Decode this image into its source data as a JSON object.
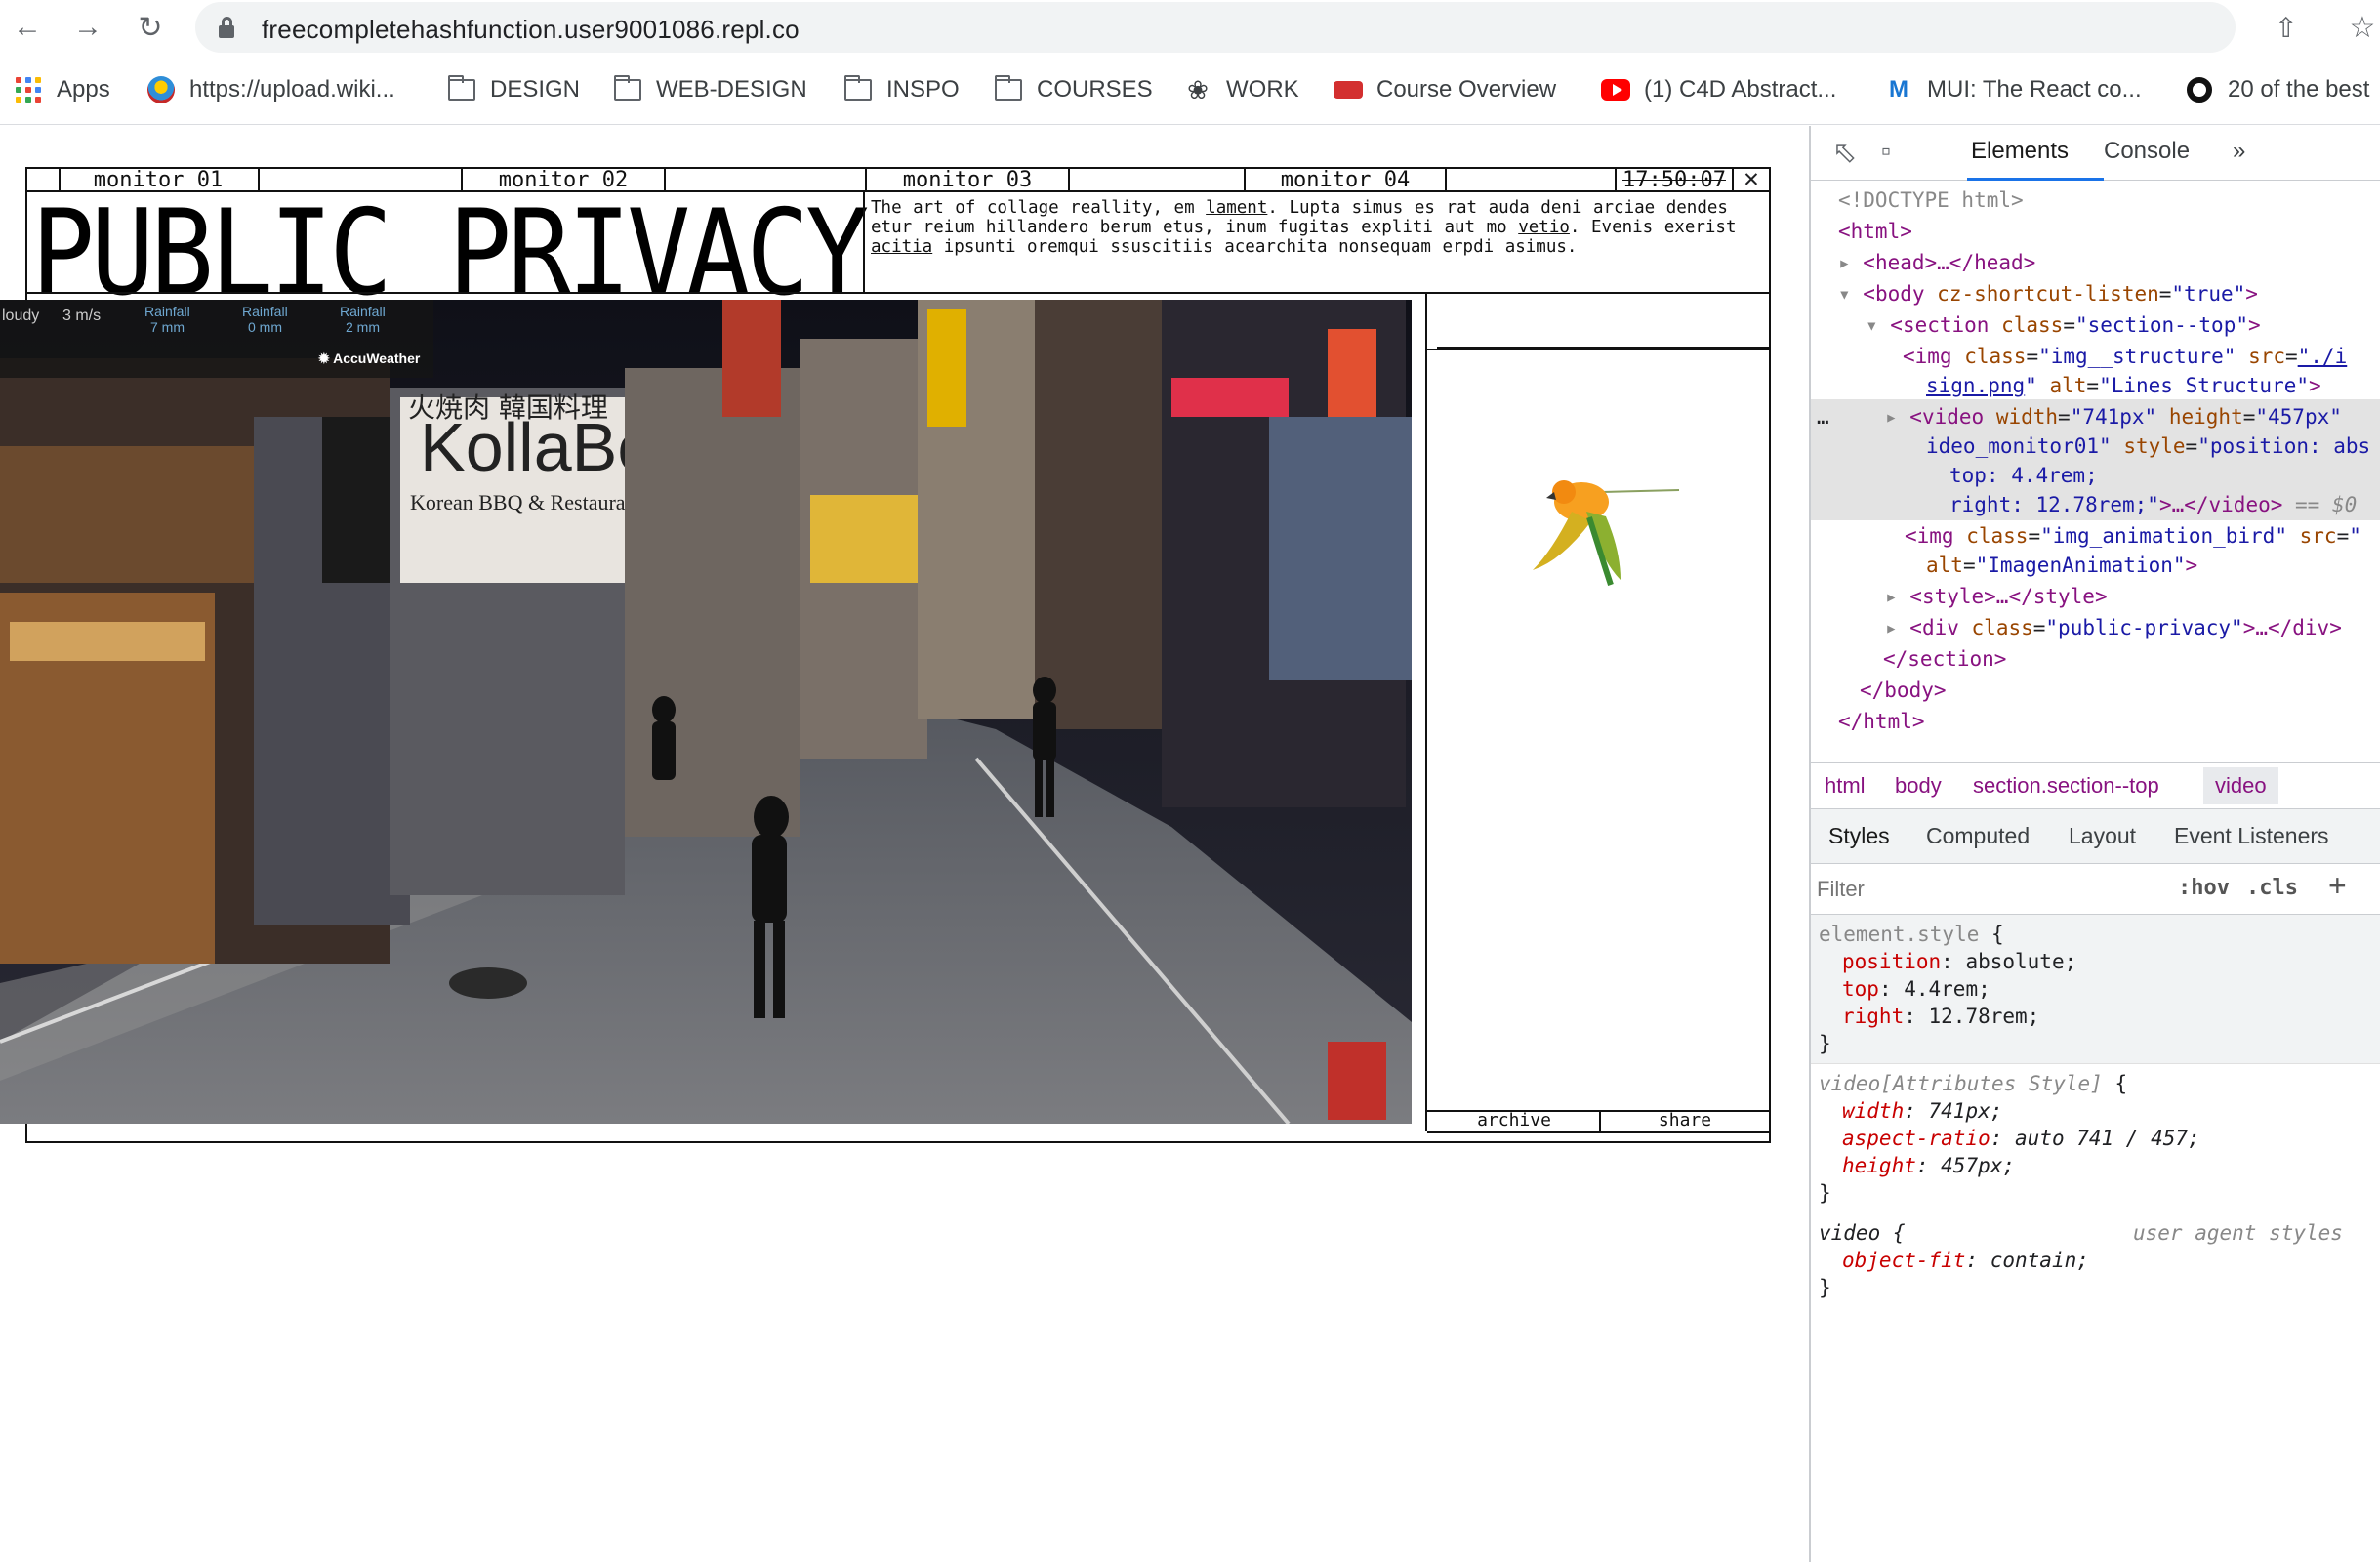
{
  "browser": {
    "url": "freecompletehashfunction.user9001086.repl.co",
    "bookmarks": [
      {
        "icon": "apps-grid-icon",
        "label": "Apps"
      },
      {
        "icon": "wikimedia-icon",
        "label": "https://upload.wiki..."
      },
      {
        "icon": "folder-icon",
        "label": "DESIGN"
      },
      {
        "icon": "folder-icon",
        "label": "WEB-DESIGN"
      },
      {
        "icon": "folder-icon",
        "label": "INSPO"
      },
      {
        "icon": "folder-icon",
        "label": "COURSES"
      },
      {
        "icon": "work-icon",
        "label": "WORK"
      },
      {
        "icon": "bus-icon",
        "label": "Course Overview"
      },
      {
        "icon": "youtube-icon",
        "label": "(1) C4D Abstract..."
      },
      {
        "icon": "mui-icon",
        "label": "MUI: The React co..."
      },
      {
        "icon": "ring-icon",
        "label": "20 of the best"
      }
    ]
  },
  "page": {
    "monitors": [
      "monitor 01",
      "monitor 02",
      "monitor 03",
      "monitor 04"
    ],
    "clock": "17:50:07",
    "close_glyph": "✕",
    "title": "PUBLIC PRIVACY",
    "description": {
      "p1": "The art of collage reallity, em ",
      "u1": "lament",
      "p2": ". Lupta simus es rat auda deni arciae dendes etur reium hillandero berum etus, inum fugitas expliti aut mo ",
      "u2": "vetio",
      "p3": ". Evenis exerist ",
      "u3": "acitia",
      "p4": " ipsunti oremqui ssuscitiis acearchita nonsequam erpdi asimus."
    },
    "weather": {
      "condition": "loudy",
      "wind": "3 m/s",
      "items": [
        {
          "label": "Rainfall",
          "value": "7 mm"
        },
        {
          "label": "Rainfall",
          "value": "0 mm"
        },
        {
          "label": "Rainfall",
          "value": "2 mm"
        }
      ],
      "brand": "AccuWeather"
    },
    "signs": {
      "restaurant": "KollaBo",
      "restaurant_sub": "Korean BBQ & Restaurant",
      "kanji_1": "火焼肉 韓国料理"
    },
    "side_buttons": [
      "archive",
      "share"
    ]
  },
  "devtools": {
    "tabs": [
      "Elements",
      "Console"
    ],
    "more": "»",
    "dom": {
      "doctype": "<!DOCTYPE html>",
      "html_open": "<html>",
      "head": "<head>…</head>",
      "body_tag": "<body",
      "body_attr": "cz-shortcut-listen",
      "body_val": "\"true\"",
      "section_tag": "<section",
      "section_attr": "class",
      "section_val": "\"section--top\"",
      "img_tag": "<img",
      "img_attr1": "class",
      "img_val1": "\"img__structure\"",
      "img_attr2": "src",
      "img_val2a": "\"./i",
      "img_val2b": "sign.png",
      "img_attr3": "alt",
      "img_val3": "\"Lines Structure\"",
      "video_tag": "<video",
      "video_attr1": "width",
      "video_val1": "\"741px\"",
      "video_attr2": "height",
      "video_val2": "\"457px\"",
      "video_val3": "ideo_monitor01\"",
      "video_attr4": "style",
      "video_val4a": "\"position: abs",
      "video_val4b": "top: 4.4rem;",
      "video_val4c": "right: 12.78rem;\"",
      "video_close": ">…</video>",
      "video_eq": "== $0",
      "bird_tag": "<img",
      "bird_attr": "class",
      "bird_val": "\"img_animation_bird\"",
      "bird_attr2": "src",
      "bird_alt": "alt",
      "bird_alt_val": "\"ImagenAnimation\"",
      "style_tag": "<style>…</style>",
      "div_tag": "<div",
      "div_attr": "class",
      "div_val": "\"public-privacy\"",
      "div_close": ">…</div>",
      "section_close": "</section>",
      "body_close": "</body>",
      "html_close": "</html>",
      "dots": "…"
    },
    "breadcrumbs": [
      "html",
      "body",
      "section.section--top",
      "video"
    ],
    "sub_tabs": [
      "Styles",
      "Computed",
      "Layout",
      "Event Listeners"
    ],
    "filter_placeholder": "Filter",
    "hov": ":hov",
    "cls": ".cls",
    "plus": "+",
    "styles": {
      "element_selector": "element.style",
      "element_props": [
        {
          "name": "position",
          "value": "absolute;"
        },
        {
          "name": "top",
          "value": "4.4rem;"
        },
        {
          "name": "right",
          "value": "12.78rem;"
        }
      ],
      "attr_selector": "video[Attributes Style]",
      "attr_props": [
        {
          "name": "width",
          "value": "741px;"
        },
        {
          "name": "aspect-ratio",
          "value": "auto 741 / 457;"
        },
        {
          "name": "height",
          "value": "457px;"
        }
      ],
      "ua_selector": "video",
      "ua_label": "user agent styles",
      "ua_props": [
        {
          "name": "object-fit",
          "value": "contain;"
        }
      ],
      "open_brace": "{",
      "close_brace": "}"
    }
  }
}
